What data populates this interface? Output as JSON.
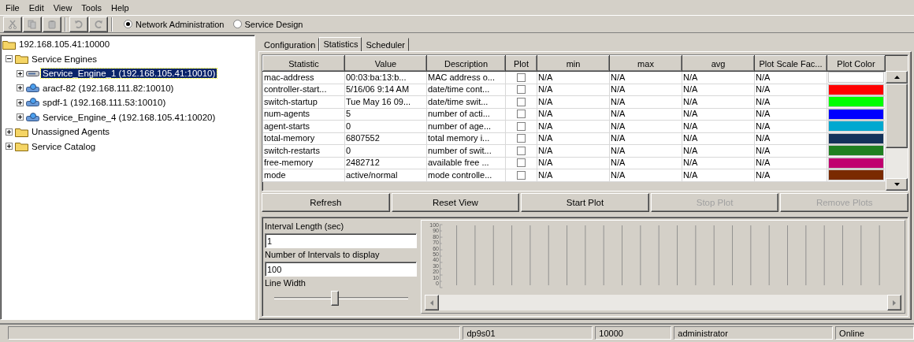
{
  "menu": [
    "File",
    "Edit",
    "View",
    "Tools",
    "Help"
  ],
  "toolbar": {
    "buttons": [
      {
        "kind": "cut",
        "disabled": true
      },
      {
        "kind": "copy",
        "disabled": true
      },
      {
        "kind": "paste",
        "disabled": true
      },
      {
        "kind": "undo",
        "disabled": true
      },
      {
        "kind": "redo",
        "disabled": true
      }
    ],
    "modes": [
      {
        "label": "Network Administration",
        "selected": true
      },
      {
        "label": "Service Design",
        "selected": false
      }
    ]
  },
  "tree": {
    "label": "192.168.105.41:10000",
    "kind": "folder",
    "selected": false,
    "children": [
      {
        "label": "Service Engines",
        "kind": "folder",
        "expanded": true,
        "selected": false,
        "children": [
          {
            "label": "Service_Engine_1 (192.168.105.41:10010)",
            "kind": "local-engine",
            "expanded": false,
            "selected": true
          },
          {
            "label": "aracf-82 (192.168.111.82:10010)",
            "kind": "remote-engine",
            "expanded": false,
            "selected": false
          },
          {
            "label": "spdf-1 (192.168.111.53:10010)",
            "kind": "remote-engine",
            "expanded": false,
            "selected": false
          },
          {
            "label": "Service_Engine_4 (192.168.105.41:10020)",
            "kind": "remote-engine",
            "expanded": false,
            "selected": false
          }
        ]
      },
      {
        "label": "Unassigned Agents",
        "kind": "folder",
        "expanded": false,
        "selected": false
      },
      {
        "label": "Service Catalog",
        "kind": "folder",
        "expanded": false,
        "selected": false
      }
    ]
  },
  "tabs": [
    {
      "label": "Configuration",
      "selected": false
    },
    {
      "label": "Statistics",
      "selected": true
    },
    {
      "label": "Scheduler",
      "selected": false
    }
  ],
  "table": {
    "columns": [
      "Statistic",
      "Value",
      "Description",
      "Plot",
      "min",
      "max",
      "avg",
      "Plot Scale Fac...",
      "Plot Color"
    ],
    "rows": [
      {
        "statistic": "mac-address",
        "value": "00:03:ba:13:b...",
        "description": "MAC address o...",
        "plot": false,
        "min": "N/A",
        "max": "N/A",
        "avg": "N/A",
        "scale": "N/A",
        "color": "#ffffff"
      },
      {
        "statistic": "controller-start...",
        "value": "5/16/06 9:14 AM",
        "description": "date/time cont...",
        "plot": false,
        "min": "N/A",
        "max": "N/A",
        "avg": "N/A",
        "scale": "N/A",
        "color": "#ff0000"
      },
      {
        "statistic": "switch-startup",
        "value": "Tue May 16 09...",
        "description": "date/time swit...",
        "plot": false,
        "min": "N/A",
        "max": "N/A",
        "avg": "N/A",
        "scale": "N/A",
        "color": "#00ff00"
      },
      {
        "statistic": "num-agents",
        "value": "5",
        "description": "number of acti...",
        "plot": false,
        "min": "N/A",
        "max": "N/A",
        "avg": "N/A",
        "scale": "N/A",
        "color": "#0000ff"
      },
      {
        "statistic": "agent-starts",
        "value": "0",
        "description": "number of age...",
        "plot": false,
        "min": "N/A",
        "max": "N/A",
        "avg": "N/A",
        "scale": "N/A",
        "color": "#00a8d0"
      },
      {
        "statistic": "total-memory",
        "value": "6807552",
        "description": "total memory i...",
        "plot": false,
        "min": "N/A",
        "max": "N/A",
        "avg": "N/A",
        "scale": "N/A",
        "color": "#13325a"
      },
      {
        "statistic": "switch-restarts",
        "value": "0",
        "description": "number of swit...",
        "plot": false,
        "min": "N/A",
        "max": "N/A",
        "avg": "N/A",
        "scale": "N/A",
        "color": "#1f8020"
      },
      {
        "statistic": "free-memory",
        "value": "2482712",
        "description": "available free ...",
        "plot": false,
        "min": "N/A",
        "max": "N/A",
        "avg": "N/A",
        "scale": "N/A",
        "color": "#c00070"
      },
      {
        "statistic": "mode",
        "value": "active/normal",
        "description": "mode controlle...",
        "plot": false,
        "min": "N/A",
        "max": "N/A",
        "avg": "N/A",
        "scale": "N/A",
        "color": "#7a2a00"
      }
    ]
  },
  "actions": [
    {
      "label": "Refresh",
      "disabled": false
    },
    {
      "label": "Reset View",
      "disabled": false
    },
    {
      "label": "Start Plot",
      "disabled": false
    },
    {
      "label": "Stop Plot",
      "disabled": true
    },
    {
      "label": "Remove Plots",
      "disabled": true
    }
  ],
  "settings": {
    "interval_label": "Interval Length (sec)",
    "interval_value": "1",
    "count_label": "Number of Intervals to display",
    "count_value": "100",
    "line_width_label": "Line Width",
    "line_width": {
      "level": 0.45
    }
  },
  "plot": {
    "y_ticks": [
      "100",
      "90",
      "80",
      "70",
      "60",
      "50",
      "40",
      "30",
      "20",
      "10",
      "0"
    ]
  },
  "status_bar": [
    "dp9s01",
    "10000",
    "administrator",
    "Online"
  ]
}
